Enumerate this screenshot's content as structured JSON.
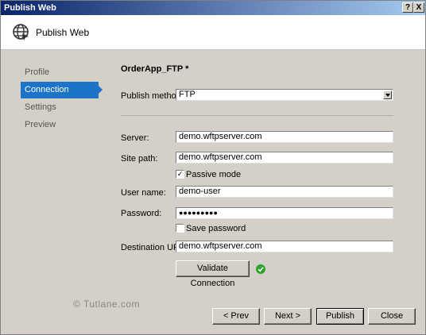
{
  "window": {
    "title": "Publish Web",
    "help_btn": "?",
    "close_btn": "X"
  },
  "header": {
    "title": "Publish Web",
    "icon": "globe-icon"
  },
  "sidebar": {
    "items": [
      {
        "label": "Profile"
      },
      {
        "label": "Connection",
        "active": true
      },
      {
        "label": "Settings"
      },
      {
        "label": "Preview"
      }
    ]
  },
  "profile_name": "OrderApp_FTP *",
  "form": {
    "publish_method_label": "Publish method:",
    "publish_method_value": "FTP",
    "server_label": "Server:",
    "server_value": "demo.wftpserver.com",
    "site_path_label": "Site path:",
    "site_path_value": "demo.wftpserver.com",
    "passive_mode_label": "Passive mode",
    "passive_mode_checked": true,
    "passive_mode_mark": "✓",
    "user_name_label": "User name:",
    "user_name_value": "demo-user",
    "password_label": "Password:",
    "password_value": "●●●●●●●●●",
    "save_password_label": "Save password",
    "save_password_checked": false,
    "destination_url_label": "Destination URL:",
    "destination_url_value": "demo.wftpserver.com",
    "validate_label": "Validate Connection"
  },
  "watermark": "© Tutlane.com",
  "footer": {
    "prev_label": "< Prev",
    "next_label": "Next >",
    "publish_label": "Publish",
    "close_label": "Close"
  },
  "colors": {
    "accent": "#1d73c8",
    "success": "#2aa42a",
    "title_bar": "#0a246a"
  }
}
